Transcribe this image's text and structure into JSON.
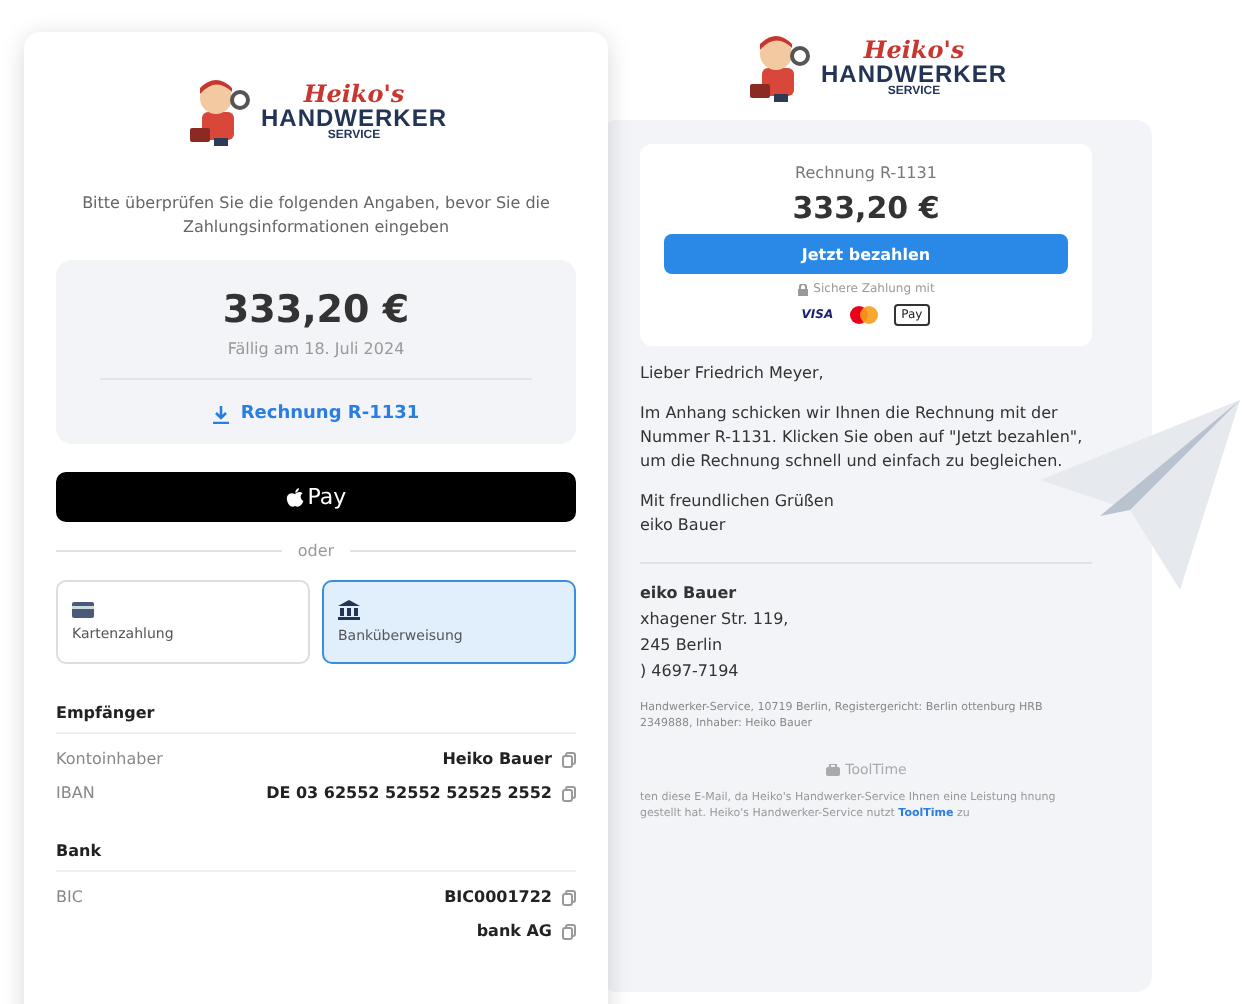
{
  "payment_page": {
    "logo": {
      "script": "Heiko's",
      "name": "HANDWERKER",
      "sub": "SERVICE"
    },
    "intro": "Bitte überprüfen Sie die folgenden Angaben, bevor Sie die Zahlungsinformationen eingeben",
    "amount": "333,20 €",
    "due": "Fällig am 18. Juli 2024",
    "invoice_link": "Rechnung R-1131",
    "apple_pay": "Pay",
    "separator": "oder",
    "methods": [
      {
        "kind": "card",
        "label": "Kartenzahlung",
        "selected": false
      },
      {
        "kind": "bank",
        "label": "Banküberweisung",
        "selected": true
      }
    ],
    "sections": [
      {
        "title": "Empfänger",
        "rows": [
          {
            "label": "Kontoinhaber",
            "value": "Heiko Bauer"
          },
          {
            "label": "IBAN",
            "value": "DE 03 62552 52552 52525 2552"
          }
        ]
      },
      {
        "title": "Bank",
        "rows": [
          {
            "label": "BIC",
            "value": "BIC0001722"
          },
          {
            "label": "",
            "value": "bank AG"
          }
        ]
      }
    ]
  },
  "email": {
    "logo": {
      "script": "Heiko's",
      "name": "HANDWERKER",
      "sub": "SERVICE"
    },
    "invoice_title": "Rechnung R-1131",
    "amount": "333,20 €",
    "pay_button": "Jetzt bezahlen",
    "secure_note": "Sichere Zahlung mit",
    "brands": [
      {
        "kind": "visa",
        "label": "VISA"
      },
      {
        "kind": "mastercard"
      },
      {
        "kind": "applepay",
        "label": "Pay"
      }
    ],
    "greeting": "Lieber Friedrich Meyer,",
    "body": "Im Anhang schicken wir Ihnen die Rechnung mit der Nummer R-1131. Klicken Sie oben auf \"Jetzt bezahlen\", um die Rechnung schnell und einfach zu begleichen.",
    "closing": [
      "Mit freundlichen Grüßen",
      "eiko Bauer"
    ],
    "contact": [
      {
        "text": "eiko Bauer",
        "bold": true
      },
      {
        "text": "xhagener Str. 119,",
        "bold": false
      },
      {
        "text": "245 Berlin",
        "bold": false
      },
      {
        "text": ") 4697-7194",
        "bold": false
      }
    ],
    "legal": "Handwerker-Service, 10719 Berlin, Registergericht: Berlin ottenburg HRB 2349888, Inhaber: Heiko Bauer",
    "provider": "ToolTime",
    "footer": "ten diese E-Mail, da Heiko's Handwerker-Service Ihnen eine Leistung hnung gestellt hat. Heiko's Handwerker-Service nutzt **ToolTime** zu"
  }
}
